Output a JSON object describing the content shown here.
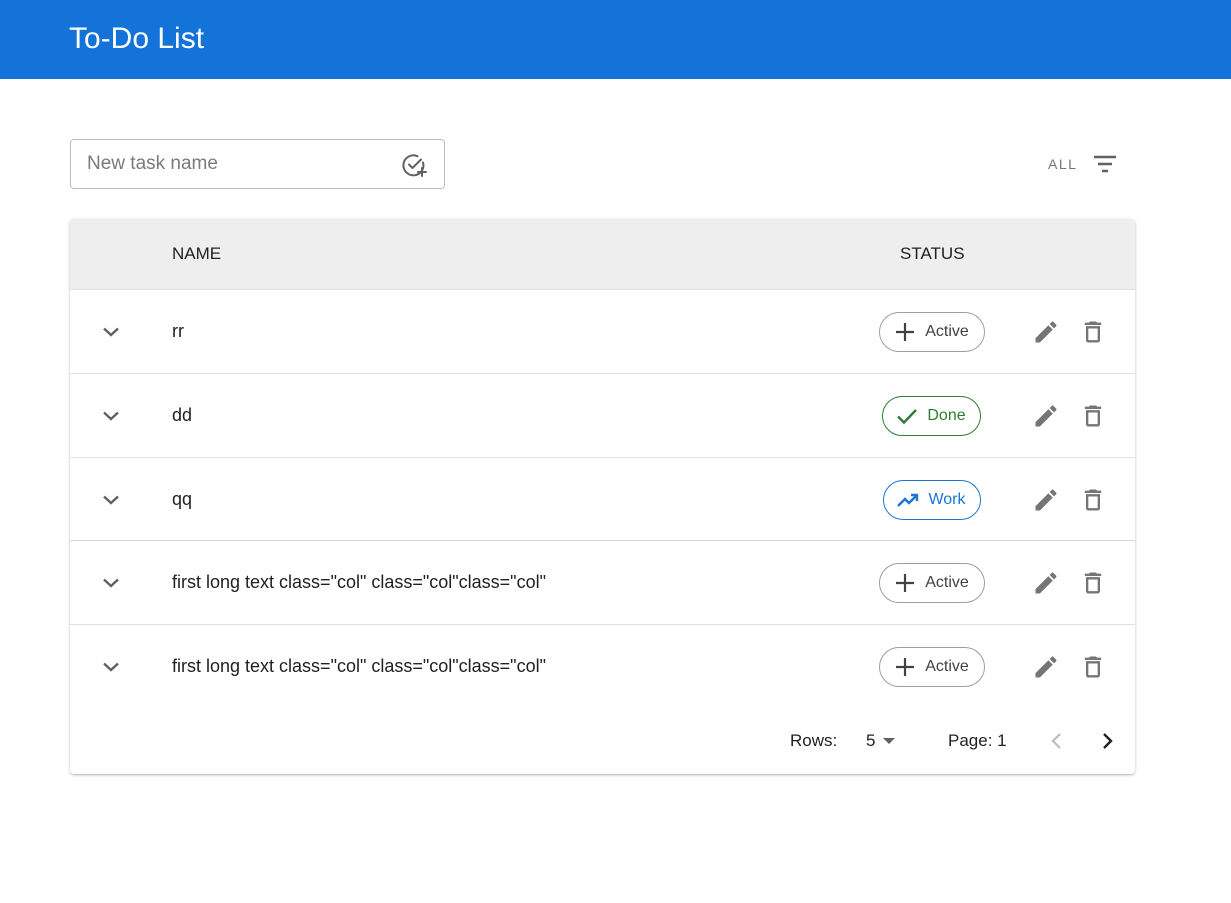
{
  "app": {
    "title": "To-Do List"
  },
  "new_task": {
    "placeholder": "New task name",
    "value": "",
    "add_icon": "add-task-icon"
  },
  "filter": {
    "label": "ALL",
    "icon": "filter-list-icon"
  },
  "table": {
    "columns": {
      "name": "NAME",
      "status": "STATUS"
    },
    "rows": [
      {
        "name": "rr",
        "status": "Active",
        "status_icon": "plus-icon"
      },
      {
        "name": "dd",
        "status": "Done",
        "status_icon": "check-icon"
      },
      {
        "name": "qq",
        "status": "Work",
        "status_icon": "trending-up-icon"
      },
      {
        "name": "first long text class=\"col\" class=\"col\"class=\"col\"",
        "status": "Active",
        "status_icon": "plus-icon"
      },
      {
        "name": "first long text class=\"col\" class=\"col\"class=\"col\"",
        "status": "Active",
        "status_icon": "plus-icon"
      }
    ]
  },
  "pagination": {
    "rows_label": "Rows:",
    "rows_value": "5",
    "page_label": "Page: 1"
  },
  "colors": {
    "appbar": "#1473d8",
    "active": "#424242",
    "done": "#2e7d32",
    "work": "#1976d2",
    "header_bg": "#eeeeee"
  }
}
